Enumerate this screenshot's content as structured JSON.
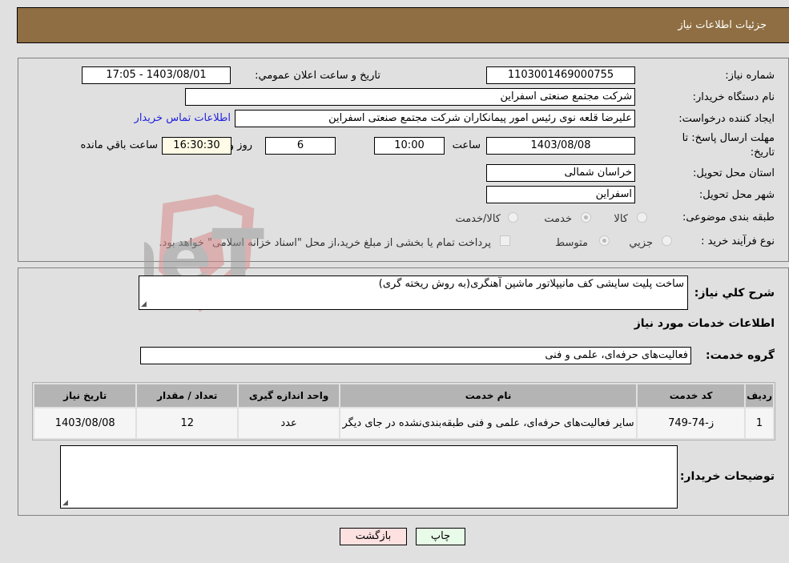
{
  "header": {
    "title": "جزئیات اطلاعات نیاز"
  },
  "form": {
    "need_number": {
      "label": "شماره نیاز:",
      "value": "1103001469000755"
    },
    "announce_datetime": {
      "label": "تاریخ و ساعت اعلان عمومي:",
      "value": "1403/08/01 - 17:05"
    },
    "buyer_org": {
      "label": "نام دستگاه خریدار:",
      "value": "شرکت مجتمع صنعتی اسفراین"
    },
    "requester": {
      "label": "ایجاد کننده درخواست:",
      "value": "علیرضا قلعه نوی رئیس امور پیمانکاران شرکت مجتمع صنعتی اسفراین",
      "contact_link": "اطلاعات تماس خریدار"
    },
    "deadline": {
      "label_line1": "مهلت ارسال پاسخ: تا",
      "label_line2": "تاریخ:",
      "date": "1403/08/08",
      "time_label": "ساعت",
      "time": "10:00",
      "days": "6",
      "days_label": "روز و",
      "remaining": "16:30:30",
      "remaining_label": "ساعت باقي مانده"
    },
    "province": {
      "label": "استان محل تحویل:",
      "value": "خراسان شمالی"
    },
    "city": {
      "label": "شهر محل تحویل:",
      "value": "اسفراین"
    },
    "category": {
      "label": "طبقه بندی موضوعی:",
      "options": [
        "کالا",
        "خدمت",
        "کالا/خدمت"
      ],
      "selected": "خدمت"
    },
    "purchase_type": {
      "label": "نوع فرآیند خرید :",
      "options": [
        "جزيي",
        "متوسط"
      ],
      "selected": "متوسط",
      "treasury_note": "پرداخت تمام یا بخشی از مبلغ خرید،از محل \"اسناد خزانه اسلامی\" خواهد بود."
    }
  },
  "details": {
    "description_label": "شرح کلي نیاز:",
    "description": "ساخت پلیت سایشی کف مانیپلاتور ماشین آهنگری(به روش ریخته گری)",
    "services_heading": "اطلاعات خدمات مورد نیاز",
    "service_group_label": "گروه خدمت:",
    "service_group": "فعالیت‌های حرفه‌ای، علمی و فنی",
    "table": {
      "headers": [
        "ردیف",
        "کد خدمت",
        "نام خدمت",
        "واحد اندازه گیری",
        "تعداد / مقدار",
        "تاریخ نیاز"
      ],
      "rows": [
        [
          "1",
          "ز-74-749",
          "سایر فعالیت‌های حرفه‌ای، علمی و فنی طبقه‌بندی‌نشده در جای دیگر",
          "عدد",
          "12",
          "1403/08/08"
        ]
      ]
    },
    "buyer_notes_label": "توضیحات خریدار:",
    "buyer_notes": ""
  },
  "buttons": {
    "print": "چاپ",
    "back": "بازگشت"
  },
  "watermark": {
    "text": "AriaTender.neT"
  },
  "colors": {
    "header_bg": "#8e6e42",
    "link": "#2222dd",
    "back_btn": "#fde0e0",
    "print_btn": "#e8fbe8"
  }
}
